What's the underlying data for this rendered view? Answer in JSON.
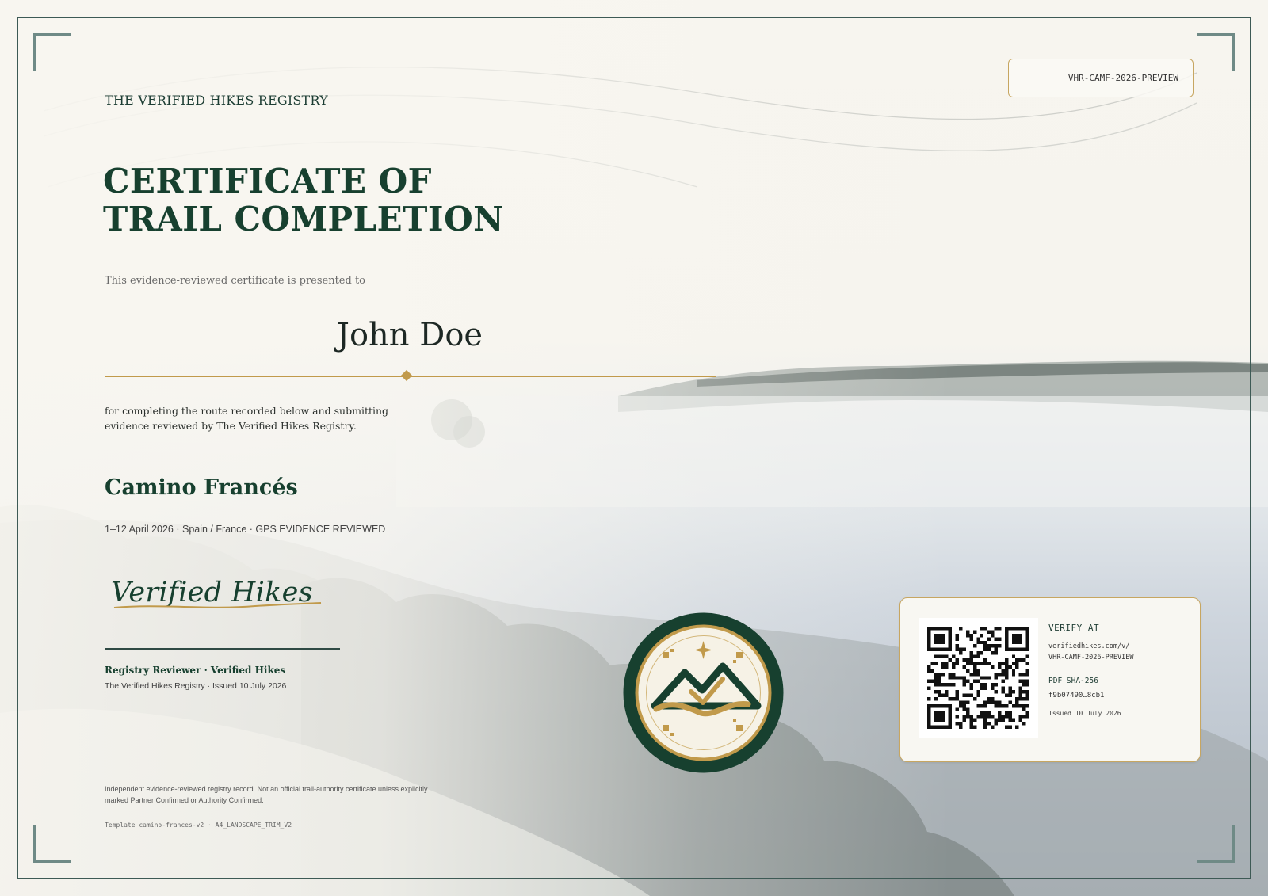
{
  "certificate": {
    "registry_name": "THE VERIFIED HIKES REGISTRY",
    "certificate_id": "VHR-CAMF-2026-PREVIEW",
    "title_line1": "CERTIFICATE OF",
    "title_line2": "TRAIL COMPLETION",
    "presented_text": "This evidence-reviewed certificate is presented to",
    "recipient_name": "John Doe",
    "completion_text": "for completing the route recorded below and submitting evidence reviewed by The Verified Hikes Registry.",
    "route_name": "Camino Francés",
    "route_meta": "1–12 April 2026 · Spain / France · GPS EVIDENCE REVIEWED",
    "signature_text": "Verified Hikes",
    "reviewer_title": "Registry Reviewer · Verified Hikes",
    "reviewer_subtitle": "The Verified Hikes Registry · Issued 10 July 2026",
    "disclaimer": "Independent evidence-reviewed registry record. Not an official trail-authority certificate unless explicitly marked Partner Confirmed or Authority Confirmed.",
    "template_info": "Template camino-frances-v2 · A4_LANDSCAPE_TRIM_V2"
  },
  "verification": {
    "label": "VERIFY AT",
    "url_line1": "verifiedhikes.com/v/",
    "url_line2": "VHR-CAMF-2026-PREVIEW",
    "sha_label": "PDF SHA-256",
    "sha_value": "f9b07490…8cb1",
    "issued": "Issued 10 July 2026"
  },
  "colors": {
    "primary_green": "#17402f",
    "gold": "#c19a4b",
    "frame": "#3d5a55"
  },
  "icons": {
    "seal": "mountain-check-seal-icon",
    "qr": "qr-code-icon"
  }
}
